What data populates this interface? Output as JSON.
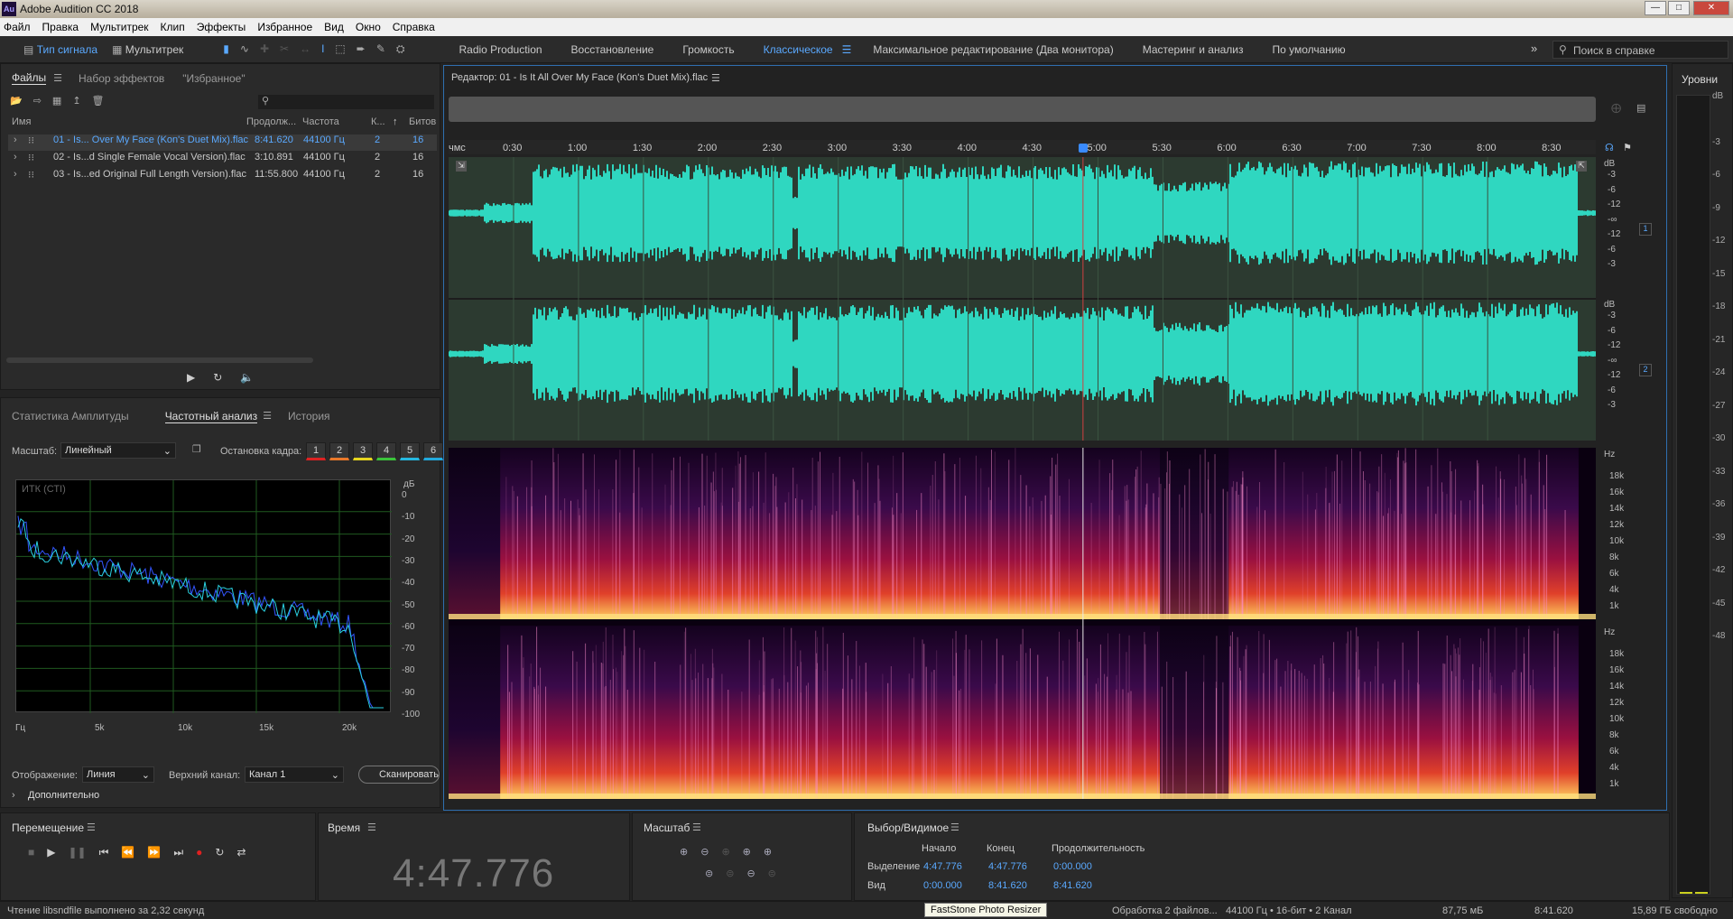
{
  "app": {
    "title": "Adobe Audition CC 2018",
    "logo": "Au"
  },
  "menu": [
    "Файл",
    "Правка",
    "Мультитрек",
    "Клип",
    "Эффекты",
    "Избранное",
    "Вид",
    "Окно",
    "Справка"
  ],
  "toolbar": {
    "mode_waveform": "Тип сигнала",
    "mode_multitrack": "Мультитрек",
    "workspaces": [
      "Radio Production",
      "Восстановление",
      "Громкость",
      "Классическое",
      "Максимальное редактирование (Два монитора)",
      "Мастеринг и анализ",
      "По умолчанию"
    ],
    "active_workspace": "Классическое",
    "help_placeholder": "Поиск в справке"
  },
  "files_panel": {
    "tabs": [
      "Файлы",
      "Набор эффектов",
      "\"Избранное\""
    ],
    "columns": [
      "Имя",
      "Продолж...",
      "Частота",
      "К...",
      "Битов"
    ],
    "rows": [
      {
        "name": "01 - Is... Over My Face (Kon's Duet Mix).flac",
        "duration": "8:41.620",
        "rate": "44100 Гц",
        "ch": "2",
        "bits": "16"
      },
      {
        "name": "02 - Is...d Single Female Vocal Version).flac",
        "duration": "3:10.891",
        "rate": "44100 Гц",
        "ch": "2",
        "bits": "16"
      },
      {
        "name": "03 - Is...ed Original Full Length Version).flac",
        "duration": "11:55.800",
        "rate": "44100 Гц",
        "ch": "2",
        "bits": "16"
      }
    ]
  },
  "analysis_panel": {
    "tabs": [
      "Статистика Амплитуды",
      "Частотный анализ",
      "История"
    ],
    "scale_label": "Масштаб:",
    "scale_value": "Линейный",
    "freeze_label": "Остановка кадра:",
    "freeze_buttons": [
      "1",
      "2",
      "3",
      "4",
      "5",
      "6"
    ],
    "freeze_colors": [
      "#d22",
      "#e8782a",
      "#e6d51f",
      "#3bc43b",
      "#25b8e0",
      "#2ad"
    ],
    "graph_label": "ИТК (СТІ)",
    "db_unit": "дБ",
    "db_ticks": [
      "0",
      "-10",
      "-20",
      "-30",
      "-40",
      "-50",
      "-60",
      "-70",
      "-80",
      "-90",
      "-100"
    ],
    "hz_ticks": [
      "Гц",
      "5k",
      "10k",
      "15k",
      "20k"
    ],
    "display_label": "Отображение:",
    "display_value": "Линия",
    "channel_label": "Верхний канал:",
    "channel_value": "Канал 1",
    "scan_button": "Сканировать",
    "more_label": "Дополнительно"
  },
  "editor": {
    "title": "Редактор: 01 - Is It All Over My Face (Kon's Duet Mix).flac",
    "ruler_unit": "чмс",
    "ruler_ticks": [
      "0:30",
      "1:00",
      "1:30",
      "2:00",
      "2:30",
      "3:00",
      "3:30",
      "4:00",
      "4:30",
      "5:00",
      "5:30",
      "6:00",
      "6:30",
      "7:00",
      "7:30",
      "8:00",
      "8:30"
    ],
    "db_unit": "dB",
    "db_labels": [
      "-3",
      "-6",
      "-12",
      "-∞",
      "-12",
      "-6",
      "-3"
    ],
    "channel_badges": [
      "1",
      "2"
    ],
    "hz_unit": "Hz",
    "hz_labels": [
      "18k",
      "16k",
      "14k",
      "12k",
      "10k",
      "8k",
      "6k",
      "4k",
      "1k"
    ],
    "playhead_fraction": 0.553
  },
  "levels": {
    "title": "Уровни",
    "ticks": [
      "dB",
      "-3",
      "-6",
      "-9",
      "-12",
      "-15",
      "-18",
      "-21",
      "-24",
      "-27",
      "-30",
      "-33",
      "-36",
      "-39",
      "-42",
      "-45",
      "-48"
    ]
  },
  "transport": {
    "title": "Перемещение"
  },
  "time_panel": {
    "title": "Время",
    "value": "4:47.776"
  },
  "zoom_panel": {
    "title": "Масштаб"
  },
  "selection_panel": {
    "title": "Выбор/Видимое",
    "headers": [
      "Начало",
      "Конец",
      "Продолжительность"
    ],
    "rows": [
      {
        "label": "Выделение",
        "start": "4:47.776",
        "end": "4:47.776",
        "duration": "0:00.000"
      },
      {
        "label": "Вид",
        "start": "0:00.000",
        "end": "8:41.620",
        "duration": "8:41.620"
      }
    ]
  },
  "status": {
    "left": "Чтение libsndfile выполнено за 2,32 секунд",
    "tooltip": "FastStone Photo Resizer",
    "processing": "Обработка 2 файлов...",
    "format": "44100 Гц • 16-бит • 2 Канал",
    "size": "87,75 мБ",
    "duration": "8:41.620",
    "free": "15,89 ГБ свободно"
  },
  "colors": {
    "accent": "#5aa9ff",
    "waveform": "#2fd7c0",
    "playhead": "#d04040"
  }
}
